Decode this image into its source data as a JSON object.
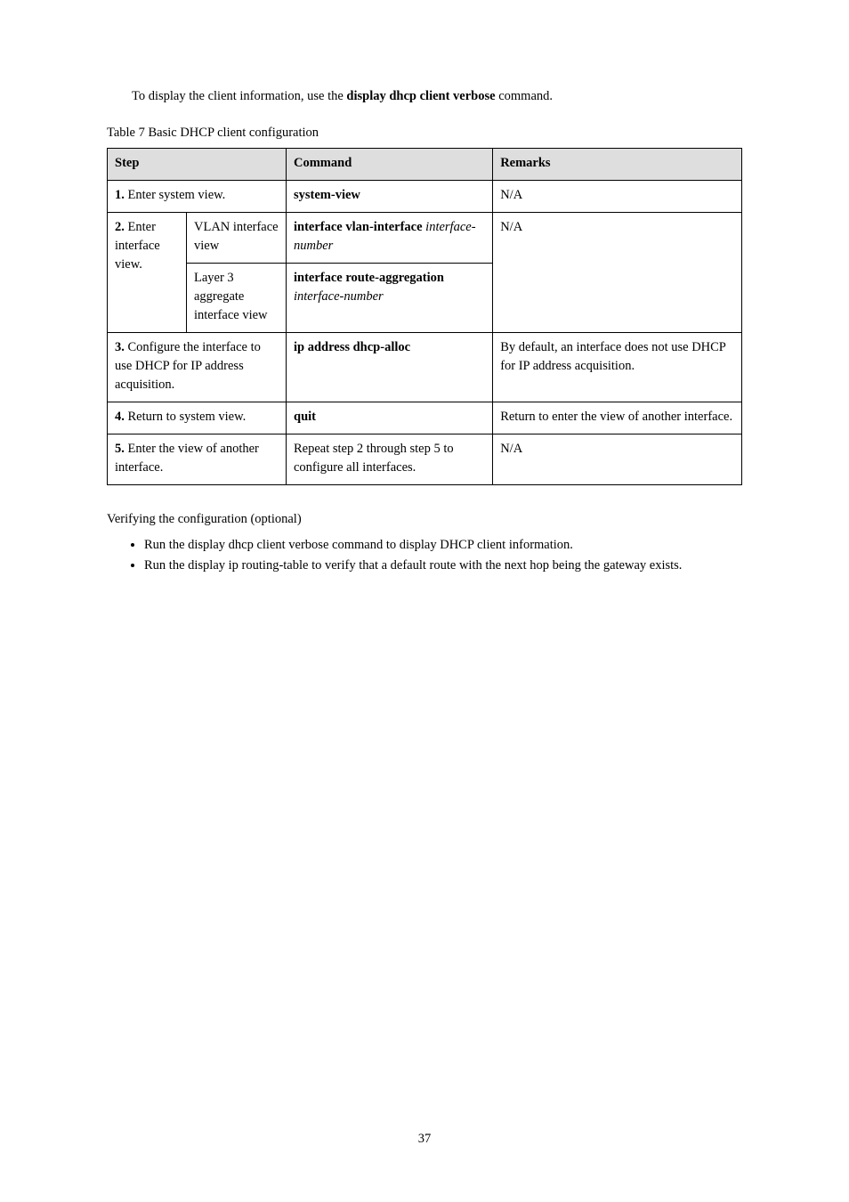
{
  "intro": "To display the client information, use the display dhcp client verbose command.",
  "table_caption": "Table 7 Basic DHCP client configuration",
  "table": {
    "headers": [
      "Step",
      "Command",
      "Remarks"
    ],
    "rows": [
      {
        "step": "1. Enter system view.",
        "command": "system-view",
        "remarks": "N/A"
      },
      {
        "step": "2. Enter interface view.",
        "subrows": [
          {
            "sublabel": "VLAN interface view",
            "command": "interface vlan-interface interface-number"
          },
          {
            "sublabel": "Layer 3 aggregate interface view",
            "command": "interface route-aggregation interface-number"
          }
        ],
        "remarks": "N/A"
      },
      {
        "step": "3. Configure the interface to use DHCP for IP address acquisition.",
        "command": "ip address dhcp-alloc",
        "remarks": "By default, an interface does not use DHCP for IP address acquisition."
      },
      {
        "step": "4. Return to system view.",
        "command": "quit",
        "remarks": "Return to enter the view of another interface."
      },
      {
        "step": "5. Enter the view of another interface.",
        "command": "Repeat step 2 through step 5 to configure all interfaces.",
        "remarks": "N/A"
      }
    ]
  },
  "verify_heading": "Verifying the configuration (optional)",
  "verify_items": [
    "Run the display dhcp client verbose command to display DHCP client information.",
    "Run the display ip routing-table to verify that a default route with the next hop being the gateway exists."
  ],
  "page_number": "37"
}
